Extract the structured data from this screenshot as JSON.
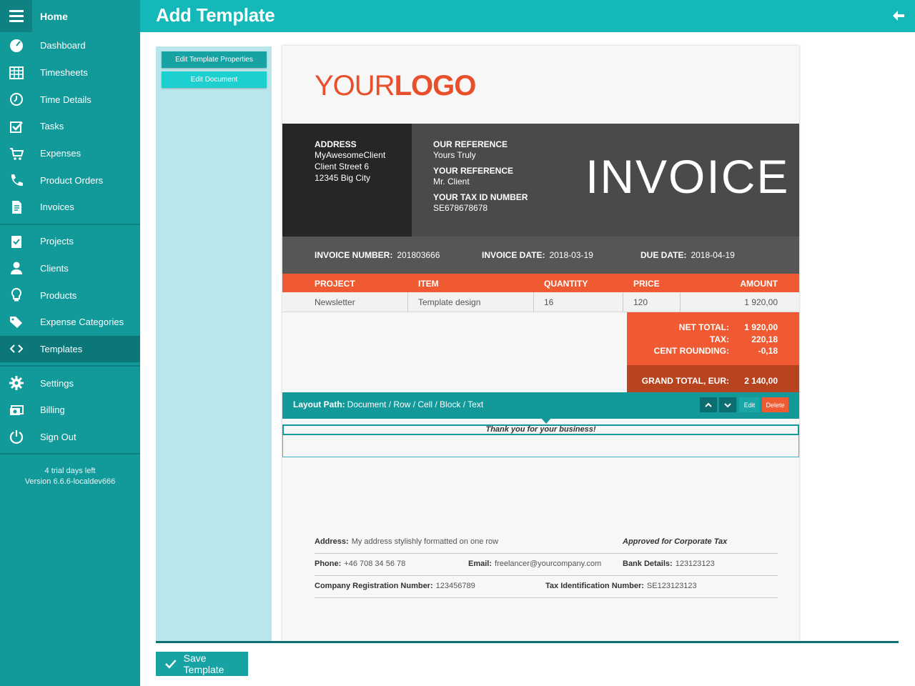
{
  "sidebar": {
    "home_label": "Home",
    "items": [
      {
        "label": "Dashboard",
        "icon": "dashboard-icon"
      },
      {
        "label": "Timesheets",
        "icon": "table-icon"
      },
      {
        "label": "Time Details",
        "icon": "clock-icon"
      },
      {
        "label": "Tasks",
        "icon": "checkbox-icon"
      },
      {
        "label": "Expenses",
        "icon": "cart-icon"
      },
      {
        "label": "Product Orders",
        "icon": "phone-icon"
      },
      {
        "label": "Invoices",
        "icon": "invoice-icon"
      },
      {
        "label": "Projects",
        "icon": "clipboard-icon"
      },
      {
        "label": "Clients",
        "icon": "user-icon"
      },
      {
        "label": "Products",
        "icon": "lightbulb-icon"
      },
      {
        "label": "Expense Categories",
        "icon": "tags-icon"
      },
      {
        "label": "Templates",
        "icon": "code-icon"
      },
      {
        "label": "Settings",
        "icon": "gear-icon"
      },
      {
        "label": "Billing",
        "icon": "money-icon"
      },
      {
        "label": "Sign Out",
        "icon": "power-icon"
      }
    ],
    "trial_text": "4 trial days left",
    "version_text": "Version 6.6.6-localdev666"
  },
  "header": {
    "title": "Add Template",
    "back_icon": "arrow-left-icon"
  },
  "panel": {
    "edit_props_label": "Edit Template Properties",
    "edit_doc_label": "Edit Document"
  },
  "invoice": {
    "logo_light": "YOUR",
    "logo_bold": "LOGO",
    "address_label": "ADDRESS",
    "address_lines": [
      "MyAwesomeClient",
      "Client Street 6",
      "12345 Big City"
    ],
    "our_ref_label": "OUR REFERENCE",
    "our_ref_value": "Yours Truly",
    "your_ref_label": "YOUR REFERENCE",
    "your_ref_value": "Mr. Client",
    "tax_id_label": "YOUR TAX ID NUMBER",
    "tax_id_value": "SE678678678",
    "title": "INVOICE",
    "number_label": "INVOICE NUMBER:",
    "number_value": "201803666",
    "date_label": "INVOICE DATE:",
    "date_value": "2018-03-19",
    "due_label": "DUE DATE:",
    "due_value": "2018-04-19",
    "columns": [
      "PROJECT",
      "ITEM",
      "QUANTITY",
      "PRICE",
      "AMOUNT"
    ],
    "row": {
      "project": "Newsletter",
      "item": "Template design",
      "quantity": "16",
      "price": "120",
      "amount": "1 920,00"
    },
    "net_total_label": "NET TOTAL:",
    "net_total_value": "1 920,00",
    "tax_label": "TAX:",
    "tax_value": "220,18",
    "rounding_label": "CENT ROUNDING:",
    "rounding_value": "-0,18",
    "grand_total_label": "GRAND TOTAL, EUR:",
    "grand_total_value": "2 140,00"
  },
  "layout_bar": {
    "prefix": "Layout Path:",
    "path": "Document / Row / Cell / Block / Text",
    "edit_label": "Edit",
    "delete_label": "Delete"
  },
  "thank_you": "Thank you for your business!",
  "footer": {
    "address_label": "Address:",
    "address_value": "My address stylishly formatted on one row",
    "approved": "Approved for Corporate Tax",
    "phone_label": "Phone:",
    "phone_value": "+46 708 34 56 78",
    "email_label": "Email:",
    "email_value": "freelancer@yourcompany.com",
    "bank_label": "Bank Details:",
    "bank_value": "123123123",
    "company_reg_label": "Company Registration Number:",
    "company_reg_value": "123456789",
    "tax_id_label": "Tax Identification Number:",
    "tax_id_value": "SE123123123"
  },
  "save_label": "Save Template",
  "colors": {
    "sidebar": "#12999a",
    "topbar": "#14b8b8",
    "accent_orange": "#f05a32",
    "dark": "#262626"
  }
}
